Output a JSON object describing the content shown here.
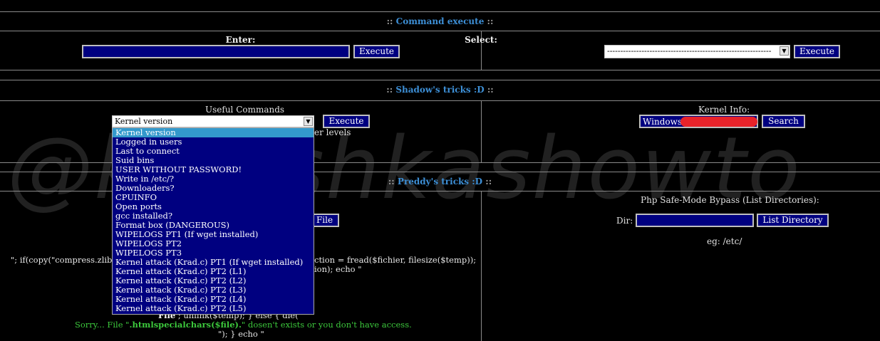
{
  "sections": {
    "command_execute": {
      "colons_left": "::",
      "title": "Command execute",
      "colons_right": "::"
    },
    "shadows_tricks": {
      "colons_left": "::",
      "title": "Shadow's tricks :D",
      "colons_right": "::"
    },
    "preddys_tricks": {
      "colons_left": "::",
      "title": "Preddy's tricks :D",
      "colons_right": "::"
    }
  },
  "command_execute": {
    "enter_label": "Enter:",
    "enter_value": "",
    "execute_label": "Execute",
    "select_label": "Select:",
    "select_value": "--------------------------------------------------------------",
    "select_execute_label": "Execute"
  },
  "useful_commands": {
    "label": "Useful Commands",
    "selected": "Kernel version",
    "execute_label": "Execute",
    "behind_text": "er levels",
    "options": [
      "Kernel version",
      "Logged in users",
      "Last to connect",
      "Suid bins",
      "USER WITHOUT PASSWORD!",
      "Write in /etc/?",
      "Downloaders?",
      "CPUINFO",
      "Open ports",
      "gcc installed?",
      "Format box (DANGEROUS)",
      "WIPELOGS PT1 (If wget installed)",
      "WIPELOGS PT2",
      "WIPELOGS PT3",
      "Kernel attack (Krad.c) PT1 (If wget installed)",
      "Kernel attack (Krad.c) PT2 (L1)",
      "Kernel attack (Krad.c) PT2 (L2)",
      "Kernel attack (Krad.c) PT2 (L3)",
      "Kernel attack (Krad.c) PT2 (L4)",
      "Kernel attack (Krad.c) PT2 (L5)"
    ],
    "selected_index": 0
  },
  "kernel_info": {
    "label": "Kernel Info:",
    "value": "Windows",
    "search_label": "Search"
  },
  "safe_mode": {
    "label": "Php Safe-Mode Bypass (List Directories):",
    "dir_label": "Dir:",
    "dir_value": "",
    "list_label": "List Directory",
    "example": "eg: /etc/"
  },
  "left_panel": {
    "file_button": "File",
    "code_line1_a": "\"; if(copy(\"compress.zlib:/",
    "code_line1_b": "ction = fread($fichier, filesize($temp));",
    "code_line2": "ion); echo \"",
    "code_line3": "; unlink($temp); } else { die(\"",
    "green_a": "Sorry... File \"",
    "green_b": ".htmlspecialchars($file).",
    "green_c": "\" dosen't exists or you don't have access.",
    "code_line4": "\"); } echo \""
  },
  "watermark": "@kanishkashowto",
  "colors": {
    "background": "#000000",
    "title": "#3d8fd6",
    "field": "#000080",
    "highlight": "#3399cc",
    "error_text": "#3cc83c"
  }
}
